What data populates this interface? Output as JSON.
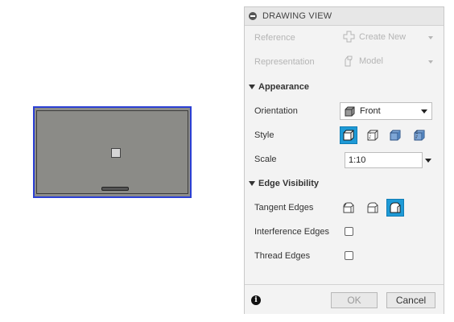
{
  "panel": {
    "title": "DRAWING VIEW",
    "reference": {
      "label": "Reference",
      "value": "Create New"
    },
    "representation": {
      "label": "Representation",
      "value": "Model"
    },
    "appearance": {
      "section_label": "Appearance",
      "orientation_label": "Orientation",
      "orientation_value": "Front",
      "style_label": "Style",
      "style_options": [
        "visible-with-hidden-edges",
        "visible-edges",
        "shaded",
        "shaded-with-hidden-edges"
      ],
      "style_selected": 0,
      "scale_label": "Scale",
      "scale_value": "1:10"
    },
    "edge_visibility": {
      "section_label": "Edge Visibility",
      "tangent_label": "Tangent Edges",
      "tangent_options": [
        "full-length",
        "shortened",
        "off"
      ],
      "tangent_selected": 2,
      "interference_label": "Interference Edges",
      "interference_checked": false,
      "thread_label": "Thread Edges",
      "thread_checked": false
    },
    "footer": {
      "ok_label": "OK",
      "cancel_label": "Cancel"
    }
  },
  "colors": {
    "accent": "#1e9ad6",
    "selection_outline": "#2b3fd4",
    "preview_fill": "#8c8c8a"
  }
}
